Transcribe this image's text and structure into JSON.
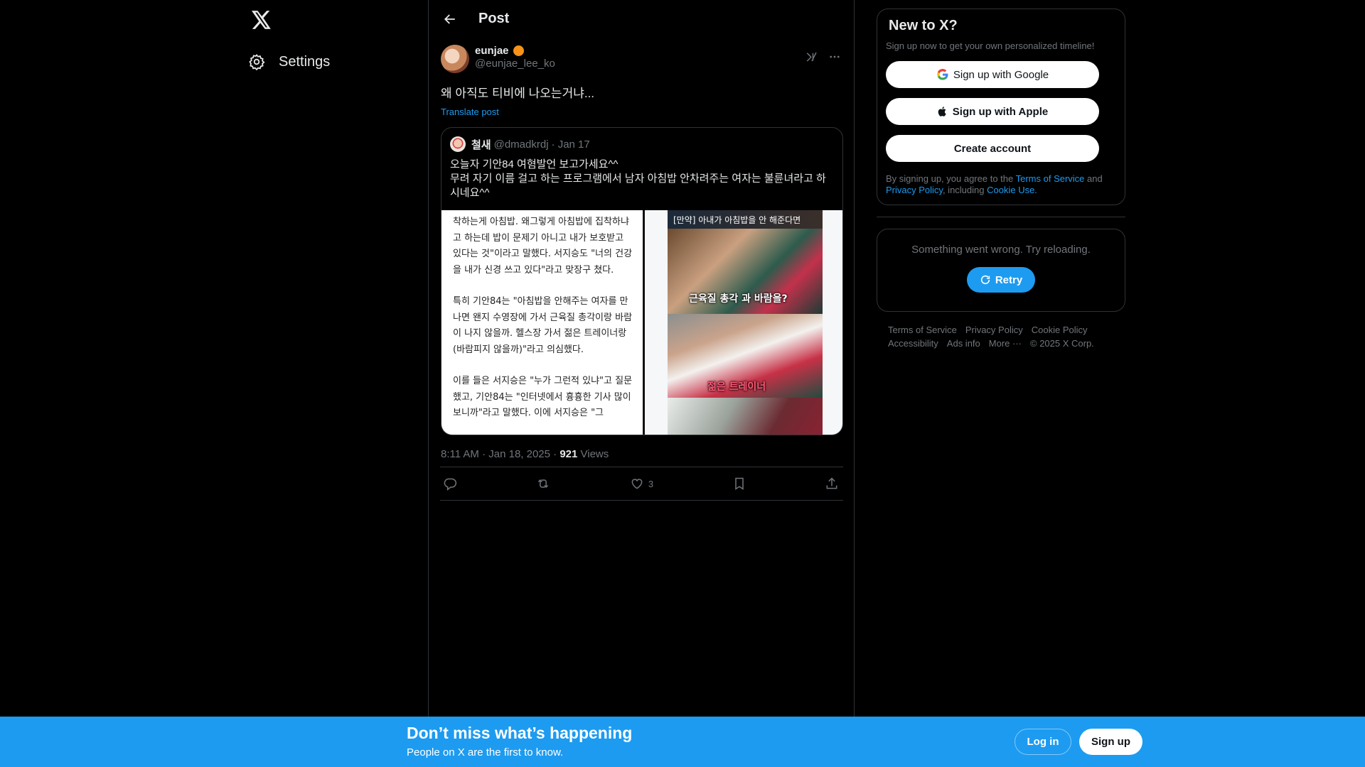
{
  "nav": {
    "logo_icon": "x-logo-icon",
    "settings_label": "Settings"
  },
  "header": {
    "title": "Post",
    "back_icon": "arrow-left-icon"
  },
  "post": {
    "display_name": "eunjae",
    "handle": "@eunjae_lee_ko",
    "text": "왜 아직도 티비에 나오는거냐...",
    "translate_label": "Translate post",
    "timestamp": "8:11 AM · Jan 18, 2025 · ",
    "views_count": "921",
    "views_label": " Views",
    "likes_count": "3",
    "quote": {
      "display_name": "철새",
      "handle": "@dmadkrdj",
      "date": "· Jan 17",
      "text_line1": "오늘자 기안84 여혐발언 보고가세요^^",
      "text_line2": "무려 자기 이름 걸고 하는 프로그램에서 남자 아침밥 안차려주는 여자는 불륜녀라고 하시네요^^",
      "article_p1": "착하는게 아침밥. 왜그렇게 아침밥에 집착하냐고 하는데 밥이 문제기 아니고 내가 보호받고 있다는 것\"이라고 말했다. 서지승도 \"너의 건강을 내가 신경 쓰고 있다\"라고 맞장구 쳤다.",
      "article_p2": "특히 기안84는 \"아침밥을 안해주는 여자를 만나면 왠지 수영장에 가서 근육질 총각이랑 바람이 나지 않을까. 헬스장 가서 젊은 트레이너랑 (바람피지 않을까)\"라고 의심했다.",
      "article_p3": "이를 들은 서지승은 \"누가 그런적 있냐\"고 질문했고, 기안84는 \"인터넷에서 흉흉한 기사 많이 보니까\"라고 말했다. 이에 서지승은 \"그",
      "video_top_caption": "[만약] 아내가 아침밥을 안 해준다면",
      "video_caption1": "근육질 총각 과 바람을?",
      "video_caption2": "젊은 트레이너"
    }
  },
  "sidebar": {
    "signup_card": {
      "title": "New to X?",
      "subtitle": "Sign up now to get your own personalized timeline!",
      "google_label": "Sign up with Google",
      "apple_label": "Sign up with Apple",
      "create_label": "Create account",
      "legal_prefix": "By signing up, you agree to the ",
      "terms_link": "Terms of Service",
      "legal_and": " and ",
      "privacy_link": "Privacy Policy",
      "legal_including": ", including ",
      "cookie_link": "Cookie Use."
    },
    "error_card": {
      "message": "Something went wrong. Try reloading.",
      "retry_label": "Retry"
    },
    "footer": {
      "terms": "Terms of Service",
      "privacy": "Privacy Policy",
      "cookie": "Cookie Policy",
      "accessibility": "Accessibility",
      "ads": "Ads info",
      "more": "More ···",
      "copyright": "© 2025 X Corp."
    }
  },
  "banner": {
    "title": "Don’t miss what’s happening",
    "subtitle": "People on X are the first to know.",
    "login_label": "Log in",
    "signup_label": "Sign up"
  },
  "colors": {
    "accent": "#1d9bf0",
    "background": "#000000",
    "border": "#2f3336",
    "muted_text": "#71767b"
  }
}
